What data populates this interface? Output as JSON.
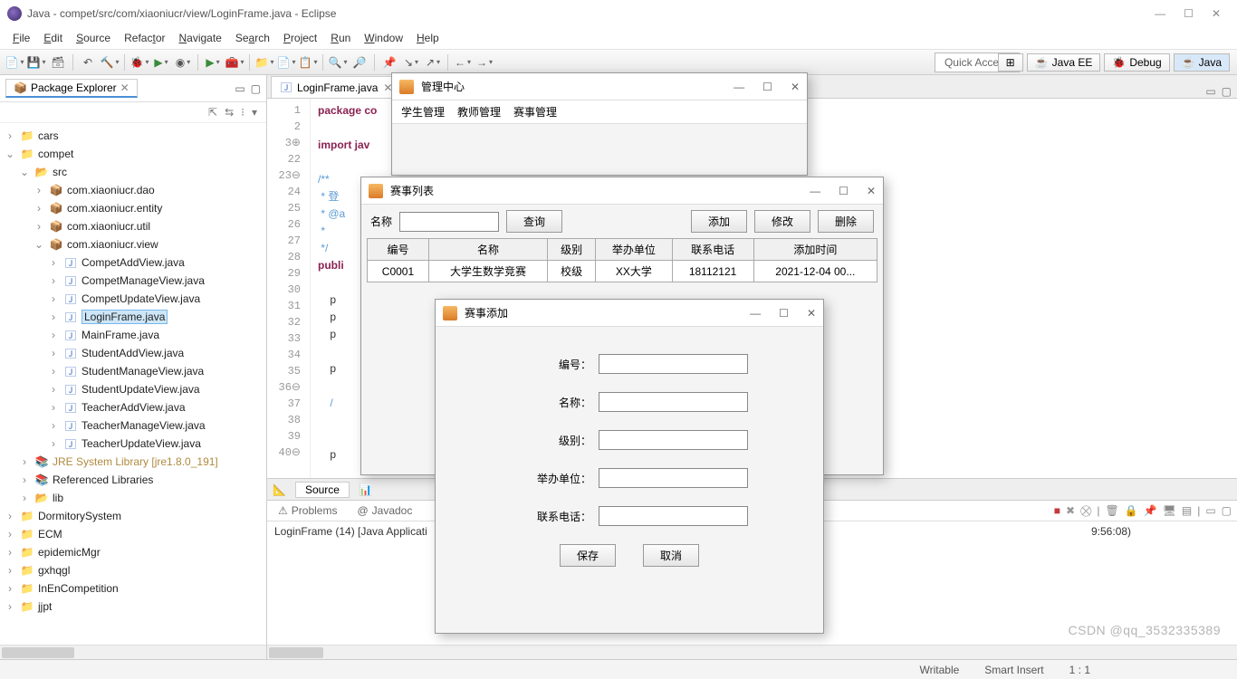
{
  "window": {
    "title": "Java - compet/src/com/xiaoniucr/view/LoginFrame.java - Eclipse"
  },
  "menu": [
    "File",
    "Edit",
    "Source",
    "Refactor",
    "Navigate",
    "Search",
    "Project",
    "Run",
    "Window",
    "Help"
  ],
  "quick_access": "Quick Access",
  "perspectives": {
    "java_ee": "Java EE",
    "debug": "Debug",
    "java": "Java"
  },
  "package_explorer": {
    "title": "Package Explorer"
  },
  "tree": [
    {
      "d": 0,
      "tw": ">",
      "ic": "prj",
      "label": "cars"
    },
    {
      "d": 0,
      "tw": "v",
      "ic": "prj",
      "label": "compet"
    },
    {
      "d": 1,
      "tw": "v",
      "ic": "fld",
      "label": "src"
    },
    {
      "d": 2,
      "tw": ">",
      "ic": "pkg",
      "label": "com.xiaoniucr.dao"
    },
    {
      "d": 2,
      "tw": ">",
      "ic": "pkg",
      "label": "com.xiaoniucr.entity"
    },
    {
      "d": 2,
      "tw": ">",
      "ic": "pkg",
      "label": "com.xiaoniucr.util"
    },
    {
      "d": 2,
      "tw": "v",
      "ic": "pkg",
      "label": "com.xiaoniucr.view"
    },
    {
      "d": 3,
      "tw": ">",
      "ic": "java",
      "label": "CompetAddView.java"
    },
    {
      "d": 3,
      "tw": ">",
      "ic": "java",
      "label": "CompetManageView.java"
    },
    {
      "d": 3,
      "tw": ">",
      "ic": "java",
      "label": "CompetUpdateView.java"
    },
    {
      "d": 3,
      "tw": ">",
      "ic": "java",
      "label": "LoginFrame.java",
      "sel": true
    },
    {
      "d": 3,
      "tw": ">",
      "ic": "java",
      "label": "MainFrame.java"
    },
    {
      "d": 3,
      "tw": ">",
      "ic": "java",
      "label": "StudentAddView.java"
    },
    {
      "d": 3,
      "tw": ">",
      "ic": "java",
      "label": "StudentManageView.java"
    },
    {
      "d": 3,
      "tw": ">",
      "ic": "java",
      "label": "StudentUpdateView.java"
    },
    {
      "d": 3,
      "tw": ">",
      "ic": "java",
      "label": "TeacherAddView.java"
    },
    {
      "d": 3,
      "tw": ">",
      "ic": "java",
      "label": "TeacherManageView.java"
    },
    {
      "d": 3,
      "tw": ">",
      "ic": "java",
      "label": "TeacherUpdateView.java"
    },
    {
      "d": 1,
      "tw": ">",
      "ic": "lib",
      "label": "JRE System Library [jre1.8.0_191]",
      "decor": true
    },
    {
      "d": 1,
      "tw": ">",
      "ic": "lib",
      "label": "Referenced Libraries"
    },
    {
      "d": 1,
      "tw": ">",
      "ic": "fld",
      "label": "lib"
    },
    {
      "d": 0,
      "tw": ">",
      "ic": "prj",
      "label": "DormitorySystem"
    },
    {
      "d": 0,
      "tw": ">",
      "ic": "prj",
      "label": "ECM"
    },
    {
      "d": 0,
      "tw": ">",
      "ic": "prj",
      "label": "epidemicMgr"
    },
    {
      "d": 0,
      "tw": ">",
      "ic": "prj",
      "label": "gxhqgl"
    },
    {
      "d": 0,
      "tw": ">",
      "ic": "prj",
      "label": "InEnCompetition"
    },
    {
      "d": 0,
      "tw": ">",
      "ic": "prj",
      "label": "jjpt"
    }
  ],
  "editor": {
    "tab": "LoginFrame.java",
    "lines": [
      {
        "n": "1",
        "t": "package co",
        "cls": "kw"
      },
      {
        "n": "2",
        "t": ""
      },
      {
        "n": "3⊕",
        "t": "import jav",
        "cls": "kw"
      },
      {
        "n": "22",
        "t": ""
      },
      {
        "n": "23⊖",
        "t": "/**",
        "cls": "cm"
      },
      {
        "n": "24",
        "t": " * 登",
        "cls": "cm"
      },
      {
        "n": "25",
        "t": " * @a",
        "cls": "cm"
      },
      {
        "n": "26",
        "t": " *",
        "cls": "cm"
      },
      {
        "n": "27",
        "t": " */",
        "cls": "cm"
      },
      {
        "n": "28",
        "t": "publi",
        "cls": "kw"
      },
      {
        "n": "29",
        "t": ""
      },
      {
        "n": "30",
        "t": "    p"
      },
      {
        "n": "31",
        "t": "    p"
      },
      {
        "n": "32",
        "t": "    p"
      },
      {
        "n": "33",
        "t": ""
      },
      {
        "n": "34",
        "t": "    p"
      },
      {
        "n": "35",
        "t": ""
      },
      {
        "n": "36⊖",
        "t": "    /",
        "cls": "cm"
      },
      {
        "n": "37",
        "t": ""
      },
      {
        "n": "38",
        "t": ""
      },
      {
        "n": "39",
        "t": "    p"
      },
      {
        "n": "40⊖",
        "t": ""
      }
    ],
    "source_tab": "Source"
  },
  "console": {
    "problems": "Problems",
    "javadoc": "Javadoc",
    "status": "LoginFrame (14) [Java Applicati",
    "status_tail": "9:56:08)"
  },
  "statusbar": {
    "writable": "Writable",
    "insert": "Smart Insert",
    "pos": "1 : 1"
  },
  "mgr": {
    "title": "管理中心",
    "menu": [
      "学生管理",
      "教师管理",
      "赛事管理"
    ]
  },
  "list": {
    "title": "赛事列表",
    "name_label": "名称",
    "query": "查询",
    "add": "添加",
    "edit": "修改",
    "del": "删除",
    "cols": [
      "编号",
      "名称",
      "级别",
      "举办单位",
      "联系电话",
      "添加时间"
    ],
    "row": [
      "C0001",
      "大学生数学竞赛",
      "校级",
      "XX大学",
      "18112121",
      "2021-12-04 00..."
    ]
  },
  "addwin": {
    "title": "赛事添加",
    "fields": [
      "编号：",
      "名称：",
      "级别：",
      "举办单位：",
      "联系电话："
    ],
    "save": "保存",
    "cancel": "取消"
  },
  "watermark": "CSDN @qq_3532335389"
}
